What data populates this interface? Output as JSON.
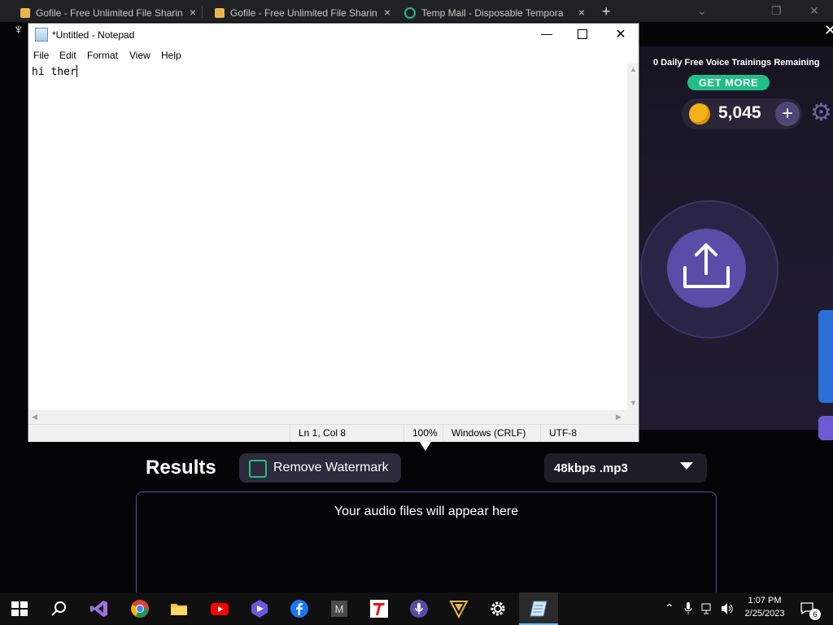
{
  "browser": {
    "tabs": [
      {
        "label": "Gofile - Free Unlimited File Sharin",
        "close": "×"
      },
      {
        "label": "Gofile - Free Unlimited File Sharin",
        "close": "×"
      },
      {
        "label": "Temp Mail - Disposable Tempora",
        "close": "×"
      }
    ],
    "new_tab": "+",
    "controls": {
      "minimize": "⌄",
      "restore": "❐",
      "close": "✕"
    }
  },
  "app": {
    "close": "✕",
    "voice_trainings": "0 Daily Free Voice Trainings Remaining",
    "get_more": "GET MORE",
    "coins": "5,045",
    "plus": "+",
    "results_title": "Results",
    "remove_watermark": "Remove Watermark",
    "format": "48kbps .mp3",
    "results_empty": "Your audio files will appear here",
    "colors": {
      "accent_green": "#1fbf86",
      "accent_purple": "#5a4da8",
      "coin": "#f3b21a"
    }
  },
  "notepad": {
    "title": "*Untitled - Notepad",
    "menu": [
      "File",
      "Edit",
      "Format",
      "View",
      "Help"
    ],
    "content": "hi ther",
    "status": {
      "position": "Ln 1, Col 8",
      "zoom": "100%",
      "line_ending": "Windows (CRLF)",
      "encoding": "UTF-8"
    }
  },
  "taskbar": {
    "icons": [
      "windows-start-icon",
      "search-icon",
      "visual-studio-icon",
      "chrome-icon",
      "file-explorer-icon",
      "youtube-icon",
      "media-player-icon",
      "facebook-icon",
      "m-app-icon",
      "t-app-icon",
      "voice-app-icon",
      "triangle-app-icon",
      "settings-icon",
      "notepad-icon"
    ],
    "time": "1:07 PM",
    "date": "2/25/2023",
    "notifications": "6"
  }
}
